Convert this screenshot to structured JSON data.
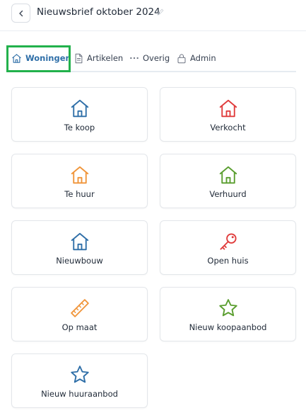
{
  "header": {
    "title": "Nieuwsbrief oktober 2024"
  },
  "tabs": [
    {
      "label": "Woningen",
      "icon": "home-icon",
      "active": true
    },
    {
      "label": "Artikelen",
      "icon": "document-icon",
      "active": false
    },
    {
      "label": "Overig",
      "icon": "dots-icon",
      "active": false
    },
    {
      "label": "Admin",
      "icon": "lock-icon",
      "active": false
    }
  ],
  "cards": [
    {
      "label": "Te koop",
      "icon": "home-icon",
      "color": "#2f6fa8"
    },
    {
      "label": "Verkocht",
      "icon": "home-icon",
      "color": "#e03c3c"
    },
    {
      "label": "Te huur",
      "icon": "home-icon",
      "color": "#f0953a"
    },
    {
      "label": "Verhuurd",
      "icon": "home-icon",
      "color": "#5a9e2f"
    },
    {
      "label": "Nieuwbouw",
      "icon": "home-icon",
      "color": "#2f6fa8"
    },
    {
      "label": "Open huis",
      "icon": "key-icon",
      "color": "#e03c3c"
    },
    {
      "label": "Op maat",
      "icon": "ruler-icon",
      "color": "#f0953a"
    },
    {
      "label": "Nieuw koopaanbod",
      "icon": "star-icon",
      "color": "#5a9e2f"
    },
    {
      "label": "Nieuw huuraanbod",
      "icon": "star-icon",
      "color": "#2f6fa8"
    }
  ],
  "colors": {
    "active_tab": "#2f6fa8",
    "highlight": "#22b14c"
  }
}
